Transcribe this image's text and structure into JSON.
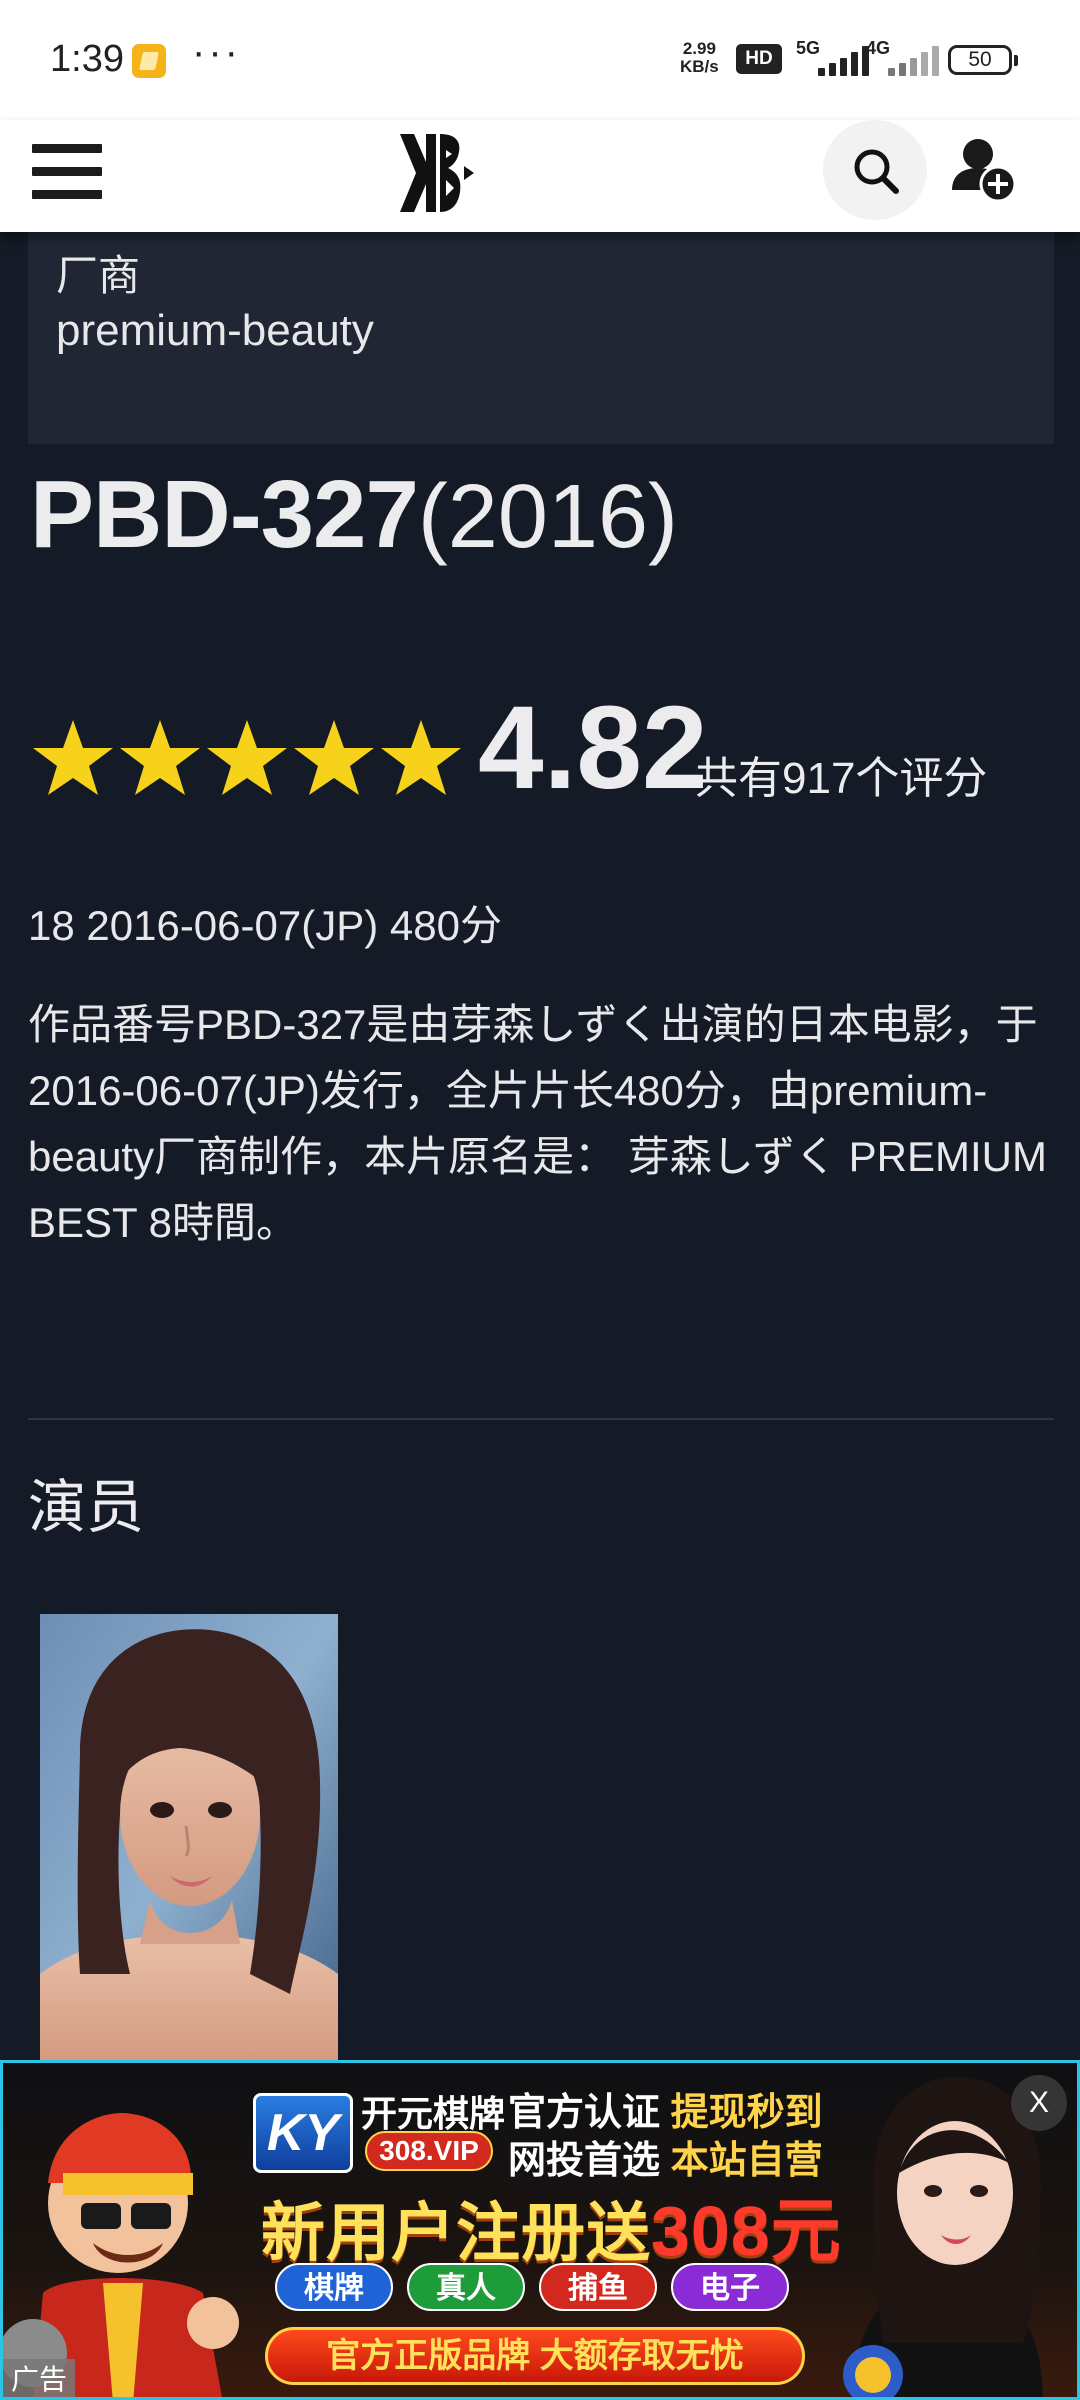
{
  "status_bar": {
    "time": "1:39",
    "dots": "···",
    "speed_value": "2.99",
    "speed_unit": "KB/s",
    "hd_badge": "HD",
    "sim1_network": "5G",
    "sim2_network": "4G",
    "battery": "50"
  },
  "header": {
    "logo_icon": "xb-logo-icon",
    "menu_icon": "hamburger-menu-icon",
    "search_icon": "search-icon",
    "add_user_icon": "add-user-icon"
  },
  "vendor": {
    "label": "厂商",
    "value": "premium-beauty"
  },
  "title": {
    "code": "PBD-327",
    "year": "(2016)"
  },
  "rating": {
    "stars": 5,
    "score": "4.82",
    "count_text": "共有917个评分",
    "star_color": "#f7d21a"
  },
  "meta": "18 2016-06-07(JP) 480分",
  "description": "作品番号PBD-327是由芽森しずく出演的日本电影，于2016-06-07(JP)发行，全片片长480分，由premium-beauty厂商制作，本片原名是： 芽森しずく PREMIUM BEST 8時間。",
  "actors_section": {
    "title": "演员"
  },
  "ad": {
    "logo": "KY",
    "brand": "开元棋牌",
    "vip": "308.VIP",
    "line1_a": "官方认证",
    "line1_b": "提现秒到",
    "line2_a": "网投首选",
    "line2_b": "本站自营",
    "headline_a": "新用户注册送",
    "headline_b": "308元",
    "pills": [
      "棋牌",
      "真人",
      "捕鱼",
      "电子"
    ],
    "bottom": "官方正版品牌 大额存取无忧",
    "close": "X",
    "tag": "广告"
  }
}
